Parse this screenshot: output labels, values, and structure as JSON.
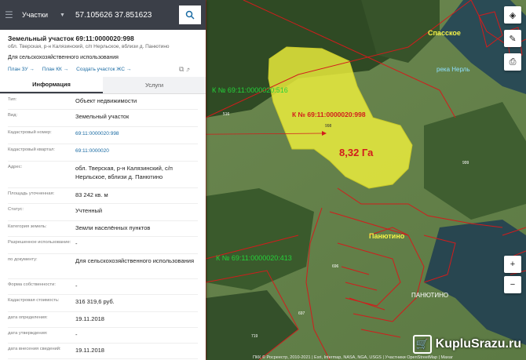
{
  "search": {
    "category": "Участки",
    "query": "57.105626 37.851623"
  },
  "parcel": {
    "title": "Земельный участок 69:11:0000020:998",
    "address_short": "обл. Тверская, р-н Калязинский, с/п Нерльское, вблизи д. Панютино",
    "purpose": "Для сельскохозяйственного использования",
    "links": [
      "План ЗУ →",
      "План КК →",
      "Создать участок ЖС →"
    ]
  },
  "tabs": {
    "info": "Информация",
    "services": "Услуги"
  },
  "props": [
    {
      "k": "Тип:",
      "v": "Объект недвижимости"
    },
    {
      "k": "Вид:",
      "v": "Земельный участок"
    },
    {
      "k": "Кадастровый номер:",
      "v": "69:11:0000020:998"
    },
    {
      "k": "Кадастровый квартал:",
      "v": "69:11:0000020"
    },
    {
      "k": "Адрес:",
      "v": "обл. Тверская, р-н Калязинский, с/п Нерльское, вблизи д. Панютино"
    },
    {
      "k": "Площадь уточненная:",
      "v": "83 242 кв. м"
    },
    {
      "k": "Статус:",
      "v": "Учтенный"
    },
    {
      "k": "Категория земель:",
      "v": "Земли населённых пунктов"
    },
    {
      "k": "Разрешенное использование:",
      "v": "-"
    },
    {
      "k": "по документу:",
      "v": "Для сельскохозяйственного использования"
    },
    {
      "k": "Форма собственности:",
      "v": "-"
    },
    {
      "k": "Кадастровая стоимость:",
      "v": "316 319,6 руб."
    },
    {
      "k": "дата определения:",
      "v": "19.11.2018"
    },
    {
      "k": "дата утверждения:",
      "v": "-"
    },
    {
      "k": "дата внесения сведений:",
      "v": "19.11.2018"
    }
  ],
  "map": {
    "label_516": "К № 69:11:0000020:516",
    "label_998": "К № 69:11:0000020:998",
    "label_413": "К № 69:11:0000020:413",
    "area": "8,32 Га",
    "village_spasskoe": "Спасское",
    "river": "река Нерль",
    "village_panyutino": "Панютино",
    "village_panyutino_caps": "ПАНЮТИНО",
    "num_998": "998",
    "num_516": "516",
    "num_999": "999",
    "num_696": "696",
    "num_697": "697",
    "num_719": "719",
    "attribution": "ПКК © Росреестр, 2010-2021 | Esri, Intermap, NASA, NGA, USGS | Участники OpenStreetMap | Maxar",
    "watermark": "KupluSrazu.ru"
  },
  "colors": {
    "parcel_fill": "#f2f23c",
    "boundary": "#d21c1c",
    "panel_dark": "#3b3f48"
  }
}
